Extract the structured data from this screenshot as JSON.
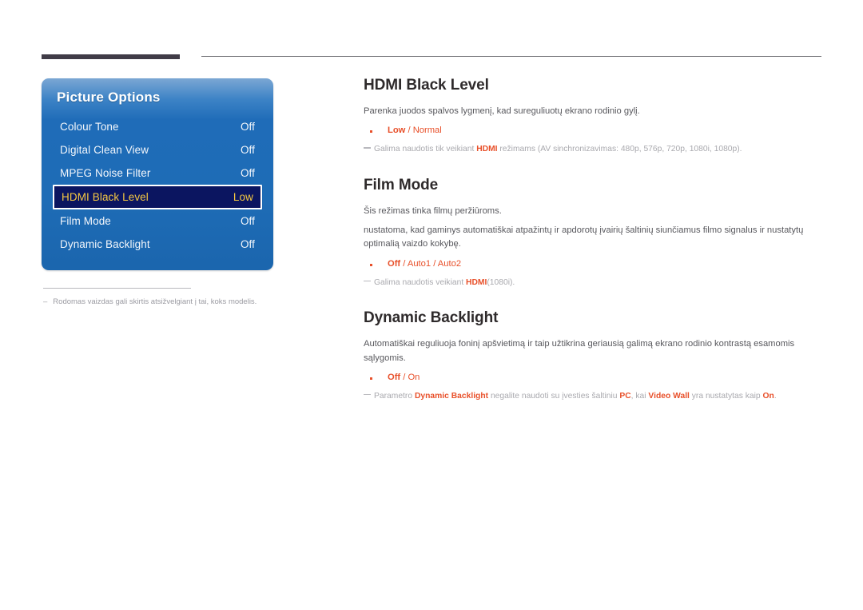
{
  "top_rules": {
    "thick_bar": "decorative-bar",
    "thin_line": "decorative-rule"
  },
  "osd": {
    "title": "Picture Options",
    "rows": [
      {
        "label": "Colour Tone",
        "value": "Off",
        "selected": false
      },
      {
        "label": "Digital Clean View",
        "value": "Off",
        "selected": false
      },
      {
        "label": "MPEG Noise Filter",
        "value": "Off",
        "selected": false
      },
      {
        "label": "HDMI Black Level",
        "value": "Low",
        "selected": true
      },
      {
        "label": "Film Mode",
        "value": "Off",
        "selected": false
      },
      {
        "label": "Dynamic Backlight",
        "value": "Off",
        "selected": false
      }
    ],
    "footnote_dash": "–",
    "footnote": "Rodomas vaizdas gali skirtis atsižvelgiant į tai, koks modelis."
  },
  "sections": [
    {
      "id": "hdmi-black-level",
      "title": "HDMI Black Level",
      "body": "Parenka juodos spalvos lygmenį, kad sureguliuotų ekrano rodinio gylį.",
      "options": {
        "bold": "Low",
        "rest": " / Normal"
      },
      "note": {
        "pre": "Galima naudotis tik veikiant ",
        "hot": "HDMI",
        "post": " režimams (AV sinchronizavimas: 480p, 576p, 720p, 1080i, 1080p)."
      }
    },
    {
      "id": "film-mode",
      "title": "Film Mode",
      "body": "Šis režimas tinka filmų peržiūroms.",
      "body2": "nustatoma, kad gaminys automatiškai atpažintų ir apdorotų įvairių šaltinių siunčiamus filmo signalus ir nustatytų optimalią vaizdo kokybę.",
      "options": {
        "bold": "Off",
        "rest": " / Auto1 / Auto2"
      },
      "note": {
        "pre": "Galima naudotis veikiant ",
        "hot": "HDMI",
        "post": "(1080i)."
      }
    },
    {
      "id": "dynamic-backlight",
      "title": "Dynamic Backlight",
      "body": "Automatiškai reguliuoja foninį apšvietimą ir taip užtikrina geriausią galimą ekrano rodinio kontrastą esamomis sąlygomis.",
      "options": {
        "bold": "Off",
        "rest": " / On"
      },
      "note_parts": {
        "p1": "Parametro ",
        "h1": "Dynamic Backlight",
        "p2": " negalite naudoti su įvesties šaltiniu ",
        "h2": "PC",
        "p3": ", kai ",
        "h3": "Video Wall",
        "p4": " yra nustatytas kaip ",
        "h4": "On",
        "p5": "."
      }
    }
  ],
  "colors": {
    "panel_blue": "#1e6cb6",
    "selected_bg": "#0b1560",
    "selected_text": "#f5c842",
    "accent_orange": "#e8502a",
    "heading": "#2e2a2b",
    "body_text": "#58585d",
    "note_text": "#a9a9ae"
  }
}
